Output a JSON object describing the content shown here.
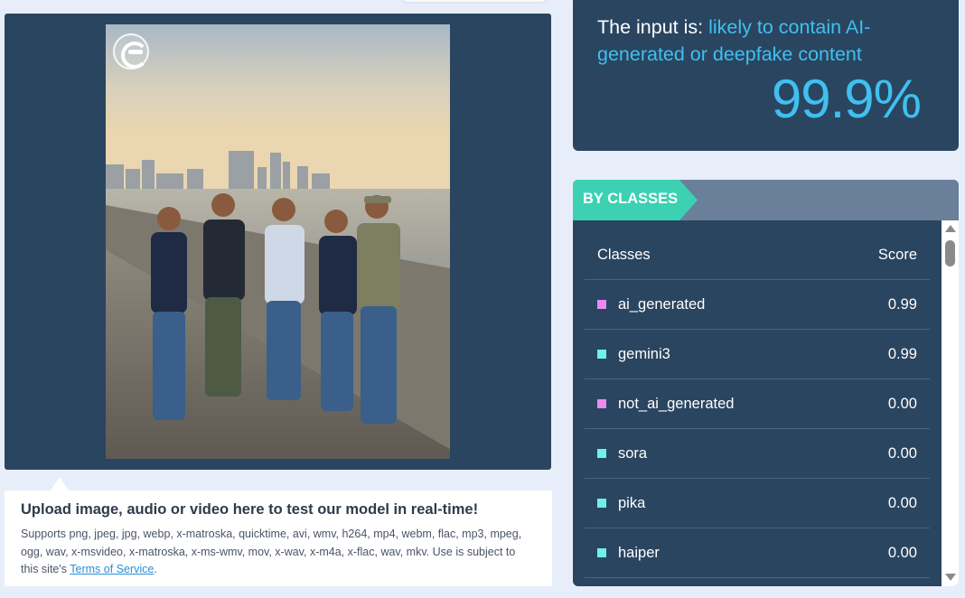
{
  "upload": {
    "title": "Upload image, audio or video here to test our model in real-time!",
    "desc": "Supports png, jpeg, jpg, webp, x-matroska, quicktime, avi, wmv, h264, mp4, webm, flac, mp3, mpeg, ogg, wav, x-msvideo, x-matroska, x-ms-wmv, mov, x-wav, x-m4a, x-flac, wav, mkv. Use is subject to this site's ",
    "terms_link": "Terms of Service",
    "desc_end": "."
  },
  "result": {
    "prefix": "The input is: ",
    "verdict": "likely to contain AI-generated or deepfake content",
    "score": "99.9%",
    "accent_color": "#3fc0f0"
  },
  "classes": {
    "tag": "BY CLASSES",
    "col_class": "Classes",
    "col_score": "Score",
    "rows": [
      {
        "name": "ai_generated",
        "score": "0.99",
        "color": "#e88af0"
      },
      {
        "name": "gemini3",
        "score": "0.99",
        "color": "#6ff0ec"
      },
      {
        "name": "not_ai_generated",
        "score": "0.00",
        "color": "#e88af0"
      },
      {
        "name": "sora",
        "score": "0.00",
        "color": "#6ff0ec"
      },
      {
        "name": "pika",
        "score": "0.00",
        "color": "#6ff0ec"
      },
      {
        "name": "haiper",
        "score": "0.00",
        "color": "#6ff0ec"
      }
    ]
  },
  "icons": {
    "watermark": "logo-watermark-icon",
    "scroll_up": "scroll-up-arrow-icon",
    "scroll_down": "scroll-down-arrow-icon"
  }
}
